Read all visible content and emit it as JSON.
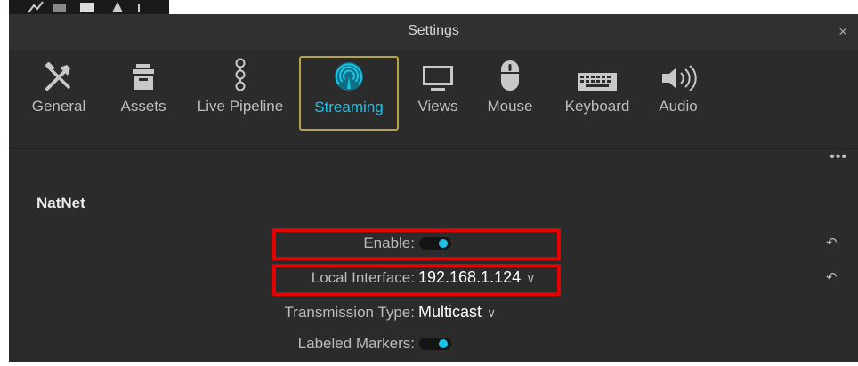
{
  "window": {
    "title": "Settings",
    "close_glyph": "×"
  },
  "tabs": [
    {
      "label": "General",
      "icon": "tools-icon",
      "active": false
    },
    {
      "label": "Assets",
      "icon": "asset-box-icon",
      "active": false
    },
    {
      "label": "Live Pipeline",
      "icon": "pipeline-icon",
      "active": false
    },
    {
      "label": "Streaming",
      "icon": "streaming-icon",
      "active": true
    },
    {
      "label": "Views",
      "icon": "monitor-icon",
      "active": false
    },
    {
      "label": "Mouse",
      "icon": "mouse-icon",
      "active": false
    },
    {
      "label": "Keyboard",
      "icon": "keyboard-icon",
      "active": false
    },
    {
      "label": "Audio",
      "icon": "speaker-icon",
      "active": false
    }
  ],
  "more_glyph": "•••",
  "section": {
    "title": "NatNet"
  },
  "settings": {
    "enable": {
      "label": "Enable:",
      "value": true
    },
    "local_interface": {
      "label": "Local Interface:",
      "value": "192.168.1.124"
    },
    "transmission_type": {
      "label": "Transmission Type:",
      "value": "Multicast"
    },
    "labeled_markers": {
      "label": "Labeled Markers:",
      "value": true
    }
  },
  "colors": {
    "accent": "#19c5e7",
    "active_border": "#b5a447",
    "highlight": "#e30000",
    "background": "#2b2b2b"
  }
}
